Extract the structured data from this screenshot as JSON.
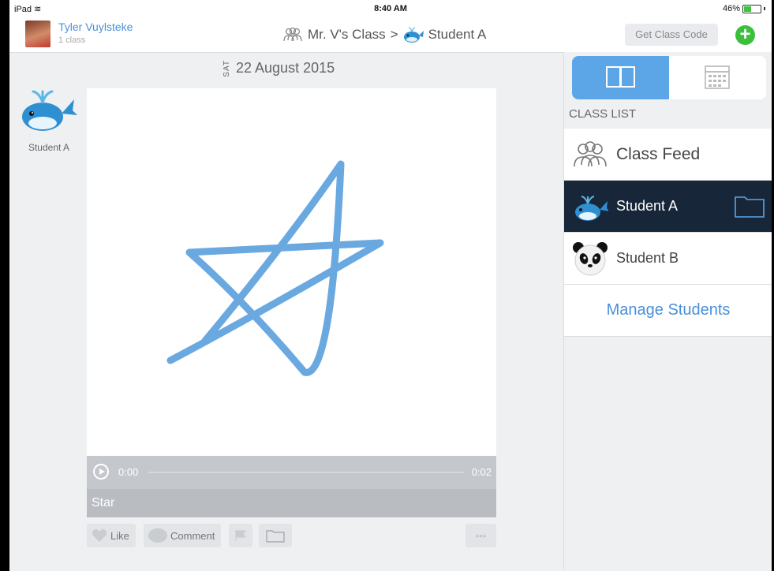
{
  "status_bar": {
    "device": "iPad",
    "time": "8:40 AM",
    "battery_percent": "46%",
    "battery_level": 0.46
  },
  "header": {
    "user_name": "Tyler Vuylsteke",
    "user_sub": "1 class",
    "breadcrumb_class": "Mr. V's Class",
    "breadcrumb_separator": ">",
    "breadcrumb_student": "Student A",
    "get_code_label": "Get Class Code",
    "add_label": "+"
  },
  "post": {
    "student_label": "Student A",
    "date_dow": "SAT",
    "date_full": "22 August 2015",
    "time_start": "0:00",
    "time_end": "0:02",
    "caption": "Star",
    "like_label": "Like",
    "comment_label": "Comment",
    "more_label": "•••"
  },
  "sidebar": {
    "section_label": "CLASS LIST",
    "rows": [
      {
        "label": "Class Feed",
        "icon": "group-icon"
      },
      {
        "label": "Student A",
        "icon": "whale-icon",
        "selected": true
      },
      {
        "label": "Student B",
        "icon": "panda-icon"
      }
    ],
    "manage_label": "Manage Students"
  },
  "colors": {
    "accent": "#4a90d9",
    "selected_row": "#172638",
    "segment_active": "#5ca6e8",
    "star_stroke": "#6aa8e0",
    "add_green": "#3cc03c"
  }
}
